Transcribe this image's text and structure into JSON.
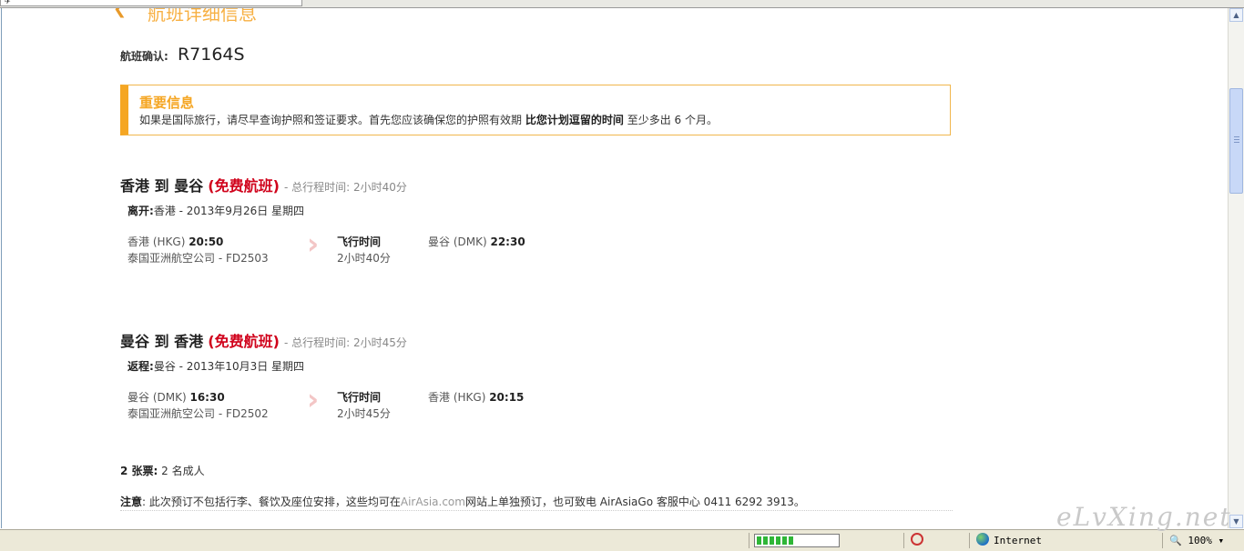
{
  "page": {
    "section_title": "航班详细信息",
    "confirmation_label": "航班确认:",
    "confirmation_code": "R7164S"
  },
  "notice": {
    "title": "重要信息",
    "text_before": "如果是国际旅行，请尽早查询护照和签证要求。首先您应该确保您的护照有效期",
    "text_bold": "比您计划逗留的时间",
    "text_after": "至少多出 6 个月。"
  },
  "flights": [
    {
      "route": "香港 到 曼谷",
      "free_label": "(免费航班)",
      "total_time": "- 总行程时间: 2小时40分",
      "date_label": "离开:",
      "date_value": "香港 - 2013年9月26日 星期四",
      "dep_place": "香港 (HKG)",
      "dep_time": "20:50",
      "airline": "泰国亚洲航空公司 - FD2503",
      "fly_label": "飞行时间",
      "fly_time": "2小时40分",
      "arr_place": "曼谷 (DMK)",
      "arr_time": "22:30"
    },
    {
      "route": "曼谷 到 香港",
      "free_label": "(免费航班)",
      "total_time": "- 总行程时间: 2小时45分",
      "date_label": "返程:",
      "date_value": "曼谷 - 2013年10月3日 星期四",
      "dep_place": "曼谷 (DMK)",
      "dep_time": "16:30",
      "airline": "泰国亚洲航空公司 - FD2502",
      "fly_label": "飞行时间",
      "fly_time": "2小时45分",
      "arr_place": "香港 (HKG)",
      "arr_time": "20:15"
    }
  ],
  "tickets": {
    "count_label": "2 张票:",
    "detail": "2 名成人"
  },
  "note": {
    "label": "注意",
    "text_before": ": 此次预订不包括行李、餐饮及座位安排，这些均可在",
    "link": "AirAsia.com",
    "text_after": "网站上单独预订，也可致电 AirAsiaGo 客服中心 0411 6292 3913。"
  },
  "statusbar": {
    "progress_fraction": 0.45,
    "zone": "Internet",
    "zoom": "100%",
    "watermark": "eLvXing.net"
  },
  "icons": {
    "back_arrow": "back-arrow-icon",
    "chevron": "chevron-right-icon",
    "globe": "globe-icon",
    "privacy": "privacy-icon"
  },
  "colors": {
    "accent": "#f5a623",
    "free_red": "#d0021b"
  }
}
